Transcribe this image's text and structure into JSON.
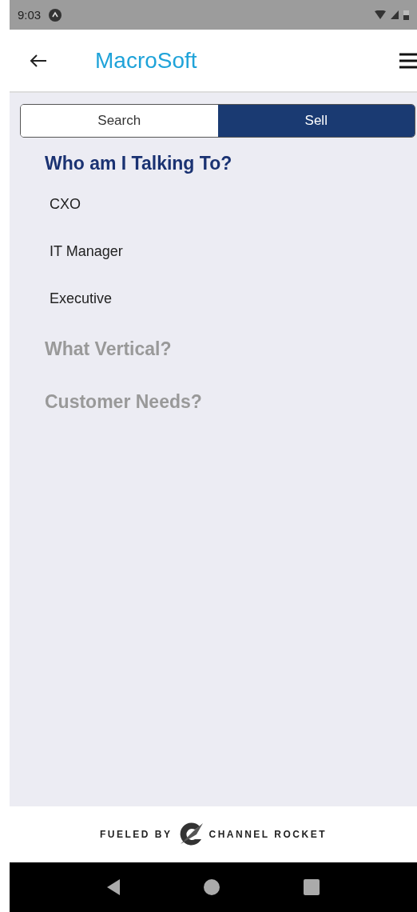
{
  "status_bar": {
    "time": "9:03"
  },
  "header": {
    "title": "MacroSoft"
  },
  "tabs": [
    {
      "label": "Search",
      "selected": false
    },
    {
      "label": "Sell",
      "selected": true
    }
  ],
  "sections": [
    {
      "title": "Who am I Talking To?",
      "expanded": true,
      "items": [
        "CXO",
        "IT Manager",
        "Executive"
      ]
    },
    {
      "title": "What Vertical?",
      "expanded": false
    },
    {
      "title": "Customer Needs?",
      "expanded": false
    }
  ],
  "footer": {
    "left": "FUELED BY",
    "right": "CHANNEL ROCKET"
  }
}
